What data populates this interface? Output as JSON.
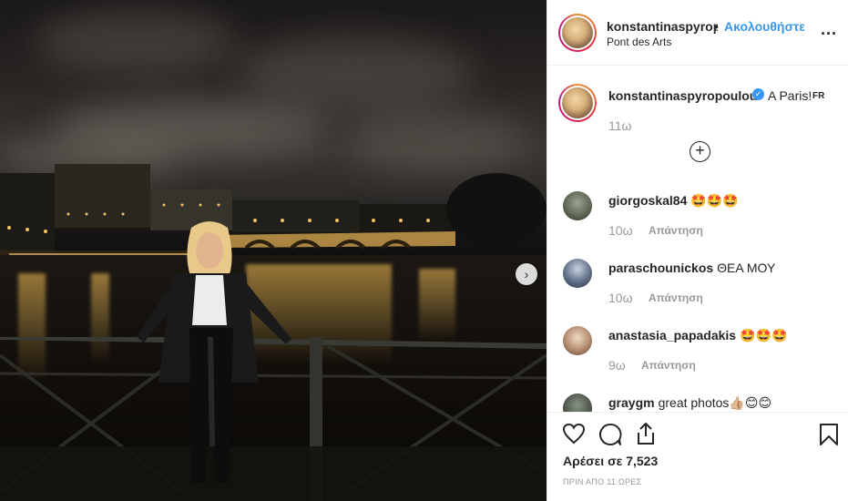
{
  "post": {
    "header_username": "konstantinaspyrop",
    "separator": "•",
    "follow_label": "Ακολουθήστε",
    "location": "Pont des Arts",
    "more_label": "..."
  },
  "caption": {
    "username": "konstantinaspyropoulou",
    "verified_icon": "verified-badge-icon",
    "text": "A Paris!",
    "lang": "FR",
    "time": "11ω",
    "load_more_icon": "plus-circle-icon"
  },
  "comments": [
    {
      "username": "giorgoskal84",
      "text": "🤩🤩🤩",
      "time": "10ω",
      "reply_label": "Απάντηση"
    },
    {
      "username": "paraschounickos",
      "text": "ΘΕΑ ΜΟΥ",
      "time": "10ω",
      "reply_label": "Απάντηση"
    },
    {
      "username": "anastasia_papadakis",
      "text": "🤩🤩🤩",
      "time": "9ω",
      "reply_label": "Απάντηση"
    },
    {
      "username": "graygm",
      "text": "great photos👍🏼😊😊",
      "time": "",
      "reply_label": ""
    }
  ],
  "actions": {
    "like_icon": "heart-icon",
    "comment_icon": "comment-icon",
    "share_icon": "share-icon",
    "save_icon": "bookmark-icon",
    "likes_text": "Αρέσει σε 7,523",
    "time_ago": "ΠΡΙΝ ΑΠΟ 11 ΩΡΕΣ"
  },
  "colors": {
    "link_blue": "#3897f0",
    "muted": "#999999",
    "text": "#262626"
  }
}
